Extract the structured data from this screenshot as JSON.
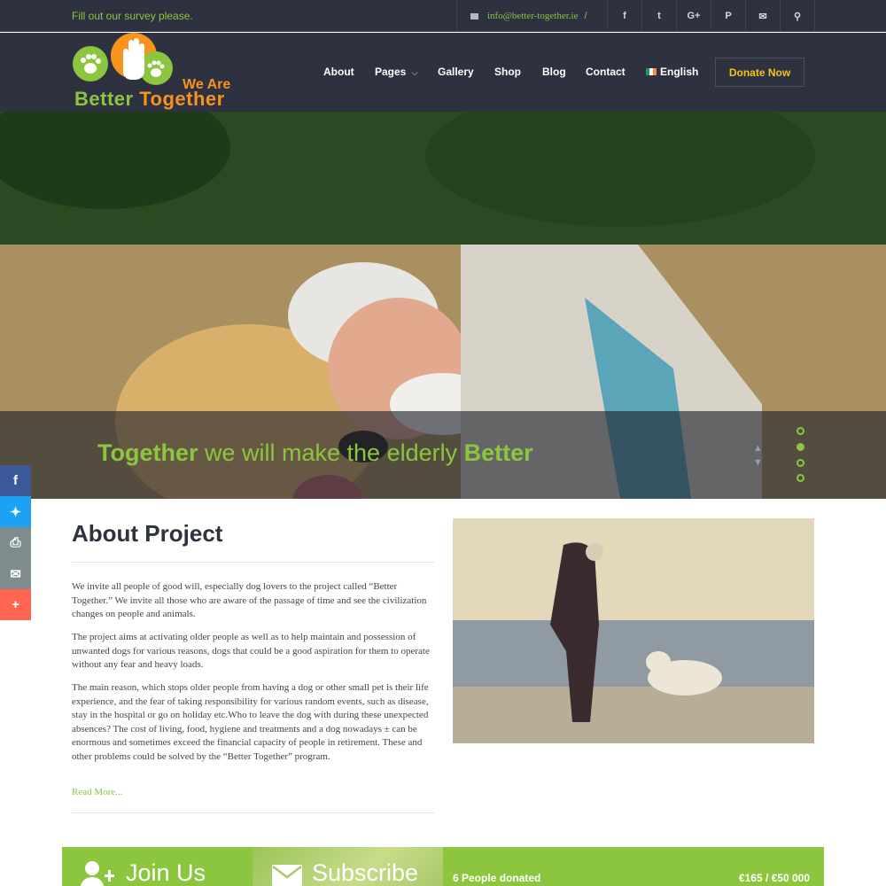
{
  "topbar": {
    "survey_text": "Fill out our survey please.",
    "email": "info@better-together.ie",
    "separator": "/",
    "social": [
      "facebook-icon",
      "twitter-icon",
      "google-plus-icon",
      "pinterest-icon",
      "envelope-icon",
      "search-icon"
    ],
    "social_glyphs": [
      "f",
      "t",
      "G+",
      "P",
      "✉",
      "⚲"
    ]
  },
  "header": {
    "logo_we_are": "We Are",
    "logo_better": "Better",
    "logo_together": "Together",
    "nav": {
      "about": "About",
      "pages": "Pages",
      "gallery": "Gallery",
      "shop": "Shop",
      "blog": "Blog",
      "contact": "Contact",
      "language": "English"
    },
    "donate_label": "Donate Now"
  },
  "hero": {
    "caption_word1": "Together",
    "caption_middle": " we will make the elderly ",
    "caption_word2": "Better",
    "slide_count": 4,
    "active_slide": 2
  },
  "share": {
    "items": [
      "facebook-icon",
      "twitter-icon",
      "print-icon",
      "email-icon",
      "plus-icon"
    ],
    "colors": [
      "#3b5998",
      "#1da1f2",
      "#7f8c8d",
      "#7f8c8d",
      "#ff6550"
    ]
  },
  "about": {
    "title": "About Project",
    "p1": "We invite all people of good will, especially dog lovers to the project called “Better Together.” We invite all those who are aware of the passage of time and see the civilization changes on people and animals.",
    "p2": "The project aims at activating older people as well as to help maintain and possession of unwanted dogs for various reasons, dogs that could be a good aspiration for them to operate without any fear and heavy loads.",
    "p3": "The main reason, which stops older people from having a dog or other small pet is their life experience, and the fear of taking responsibility for various random events, such as disease, stay in the hospital or go on holiday etc.Who to leave the dog with during these unexpected absences? The cost of living, food, hygiene and treatments and a dog nowadays ± can be enormous and sometimes exceed the financial capacity of people in retirement. These and other problems could be solved by the “Better Together” program.",
    "read_more": "Read More..."
  },
  "bottom": {
    "join_label": "Join Us",
    "subscribe_label": "Subscribe",
    "donated_text": "6 People donated",
    "amount_text": "€165 / €50 000"
  },
  "colors": {
    "accent_green": "#8cc63f",
    "accent_orange": "#f7941d",
    "dark_bg": "#2e3140",
    "donate_text": "#f5c518"
  }
}
